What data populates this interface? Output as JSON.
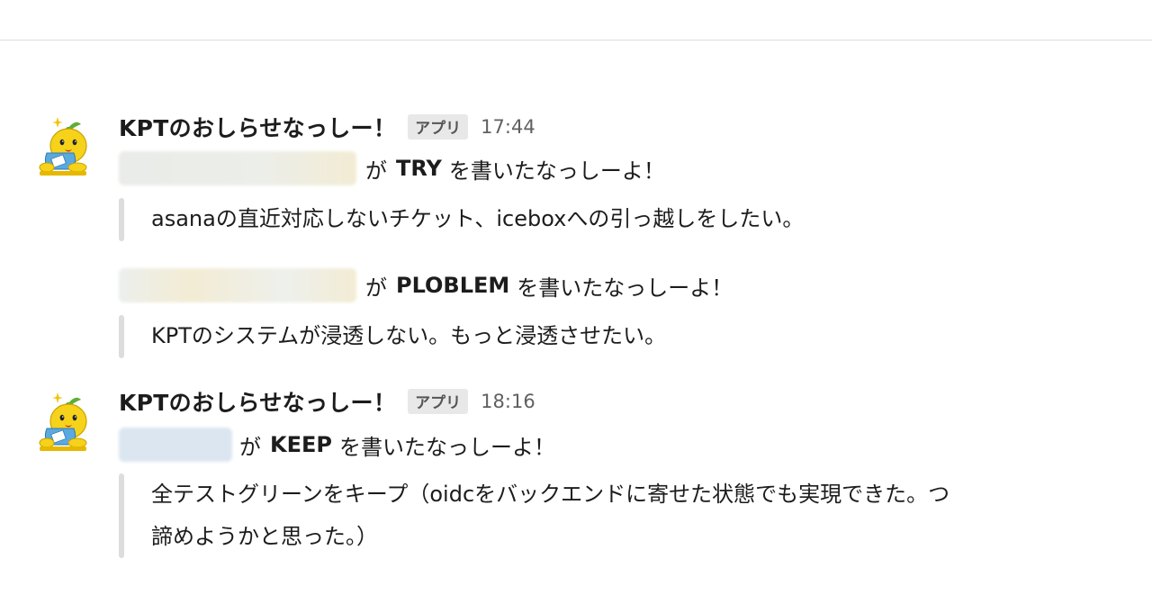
{
  "messages": [
    {
      "sender": "KPTのおしらせなっしー！",
      "badge": "アプリ",
      "time": "17:44",
      "posts": [
        {
          "verb_prefix": "が",
          "category": "TRY",
          "verb_suffix": "を書いたなっしーよ！",
          "quote": "asanaの直近対応しないチケット、iceboxへの引っ越しをしたい。"
        },
        {
          "verb_prefix": "が",
          "category": "PLOBLEM",
          "verb_suffix": "を書いたなっしーよ！",
          "quote": "KPTのシステムが浸透しない。もっと浸透させたい。"
        }
      ]
    },
    {
      "sender": "KPTのおしらせなっしー！",
      "badge": "アプリ",
      "time": "18:16",
      "posts": [
        {
          "verb_prefix": "が",
          "category": "KEEP",
          "verb_suffix": "を書いたなっしーよ！",
          "quote_lines": [
            "全テストグリーンをキープ（oidcをバックエンドに寄せた状態でも実現できた。つ",
            "諦めようかと思った。）"
          ]
        }
      ]
    }
  ],
  "colors": {
    "text": "#1d1c1d",
    "timestamp": "#616061",
    "badge_bg": "#e8e8e8",
    "quote_bar": "#dddddd",
    "blur_yellow": "#f3ecd4",
    "blur_blue": "#dbe6f0"
  }
}
